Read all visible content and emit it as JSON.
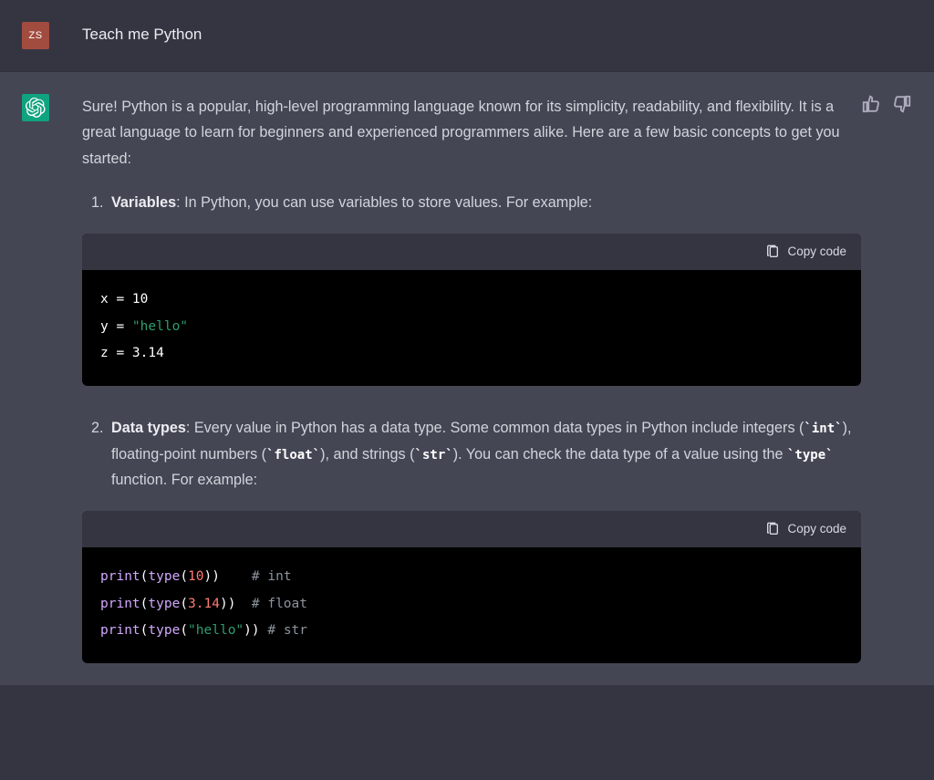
{
  "user": {
    "initials": "ZS",
    "message": "Teach me Python"
  },
  "feedback": {
    "thumbs_up": "thumbs-up-icon",
    "thumbs_down": "thumbs-down-icon"
  },
  "copy_label": "Copy code",
  "assistant": {
    "intro": "Sure! Python is a popular, high-level programming language known for its simplicity, readability, and flexibility. It is a great language to learn for beginners and experienced programmers alike. Here are a few basic concepts to get you started:",
    "items": [
      {
        "num": "1.",
        "title": "Variables",
        "desc_after_title": ": In Python, you can use variables to store values. For example:",
        "code_tokens": [
          [
            {
              "cls": "plain",
              "t": "x = "
            },
            {
              "cls": "plain",
              "t": "10"
            }
          ],
          [
            {
              "cls": "plain",
              "t": "y = "
            },
            {
              "cls": "str",
              "t": "\"hello\""
            }
          ],
          [
            {
              "cls": "plain",
              "t": "z = "
            },
            {
              "cls": "plain",
              "t": "3.14"
            }
          ]
        ]
      },
      {
        "num": "2.",
        "title": "Data types",
        "desc_segments": [
          {
            "t": ": Every value in Python has a data type. Some common data types in Python include integers ("
          },
          {
            "code": "`int`"
          },
          {
            "t": "), floating-point numbers ("
          },
          {
            "code": "`float`"
          },
          {
            "t": "), and strings ("
          },
          {
            "code": "`str`"
          },
          {
            "t": "). You can check the data type of a value using the "
          },
          {
            "code": "`type`"
          },
          {
            "t": " function. For example:"
          }
        ],
        "code_tokens": [
          [
            {
              "cls": "fn",
              "t": "print"
            },
            {
              "cls": "plain",
              "t": "("
            },
            {
              "cls": "fn",
              "t": "type"
            },
            {
              "cls": "plain",
              "t": "("
            },
            {
              "cls": "num",
              "t": "10"
            },
            {
              "cls": "plain",
              "t": "))    "
            },
            {
              "cls": "cmt",
              "t": "# int"
            }
          ],
          [
            {
              "cls": "fn",
              "t": "print"
            },
            {
              "cls": "plain",
              "t": "("
            },
            {
              "cls": "fn",
              "t": "type"
            },
            {
              "cls": "plain",
              "t": "("
            },
            {
              "cls": "num",
              "t": "3.14"
            },
            {
              "cls": "plain",
              "t": "))  "
            },
            {
              "cls": "cmt",
              "t": "# float"
            }
          ],
          [
            {
              "cls": "fn",
              "t": "print"
            },
            {
              "cls": "plain",
              "t": "("
            },
            {
              "cls": "fn",
              "t": "type"
            },
            {
              "cls": "plain",
              "t": "("
            },
            {
              "cls": "str",
              "t": "\"hello\""
            },
            {
              "cls": "plain",
              "t": ")) "
            },
            {
              "cls": "cmt",
              "t": "# str"
            }
          ]
        ]
      }
    ]
  }
}
